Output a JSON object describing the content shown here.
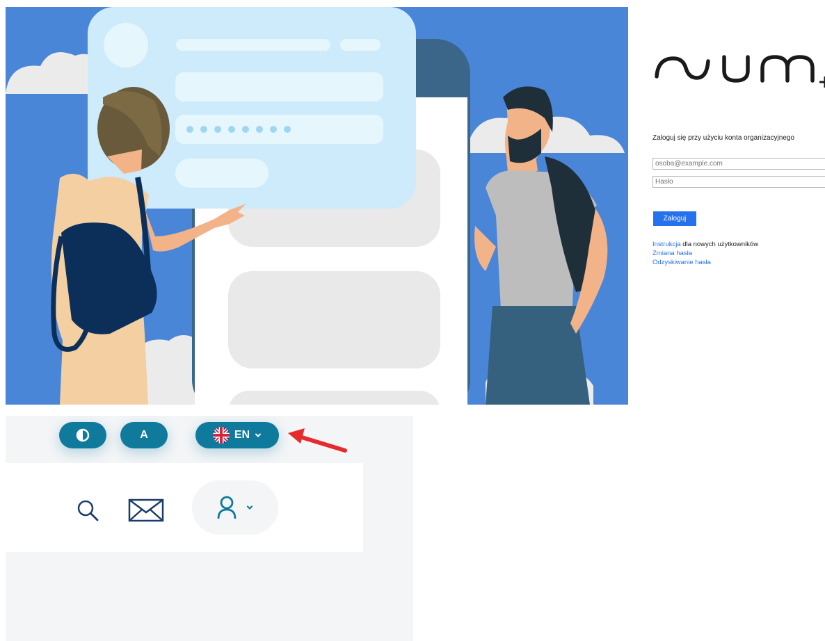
{
  "login": {
    "brand": "SUM",
    "heading": "Zaloguj się przy użyciu konta organizacyjnego",
    "email_placeholder": "osoba@example.com",
    "password_placeholder": "Hasło",
    "submit_label": "Zaloguj",
    "links": {
      "instructions_link": "Instrukcja",
      "instructions_suffix": " dla nowych użytkowników",
      "change_password": "Zmiana hasła",
      "recover_password": "Odzyskiwanie hasła"
    }
  },
  "illustration": {
    "card_password_dots": "●  ●  ●  ●  ●  ●  ●"
  },
  "header_widget": {
    "font_size_label": "A",
    "language_code": "EN",
    "icons": [
      "contrast-icon",
      "uk-flag-icon",
      "chevron-down-icon",
      "search-icon",
      "mail-icon",
      "user-icon"
    ]
  },
  "colors": {
    "accent": "#0f7a9c",
    "login_button": "#2672ec",
    "illustration_bg": "#4a86d8",
    "annotation_arrow": "#e52b2b"
  }
}
